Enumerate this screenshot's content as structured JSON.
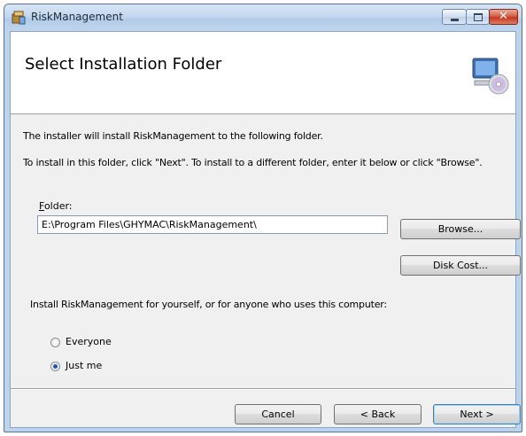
{
  "window": {
    "title": "RiskManagement"
  },
  "banner": {
    "title": "Select Installation Folder"
  },
  "body": {
    "intro": "The installer will install RiskManagement to the following folder.",
    "instructions": "To install in this folder, click \"Next\". To install to a different folder, enter it below or click \"Browse\".",
    "folder_label_prefix": "",
    "folder_label_mnemonic": "F",
    "folder_label_rest": "older:",
    "folder_value": "E:\\Program Files\\GHYMAC\\RiskManagement\\",
    "browse_label": "Browse...",
    "disk_cost_label": "Disk Cost...",
    "install_for_prompt": "Install RiskManagement for yourself, or for anyone who uses this computer:",
    "options": [
      {
        "label": "Everyone",
        "selected": false
      },
      {
        "label": "Just me",
        "selected": true
      }
    ]
  },
  "footer": {
    "cancel_label": "Cancel",
    "back_label": "< Back",
    "next_label": "Next >"
  }
}
